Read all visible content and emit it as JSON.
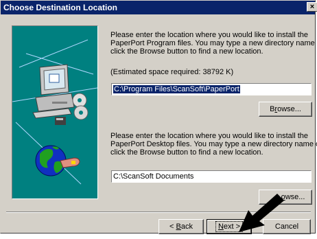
{
  "window": {
    "title": "Choose Destination Location",
    "close_label": "×"
  },
  "program_section": {
    "para_lines": [
      "Please enter the location where you would like to install the",
      "PaperPort Program files.  You may type a new directory name or",
      "click the Browse button to find a new location."
    ],
    "space_note": "(Estimated space required:  38792 K)",
    "path_value": "C:\\Program Files\\ScanSoft\\PaperPort",
    "browse_label_pre": "B",
    "browse_label_u": "r",
    "browse_label_post": "owse..."
  },
  "desktop_section": {
    "para_lines": [
      "Please enter the location where you would like to install the",
      "PaperPort Desktop files.  You may type a new directory name or",
      "click the Browse button to find a new location."
    ],
    "path_value": "C:\\ScanSoft Documents",
    "browse_label_u": "o",
    "browse_label_post": "wse..."
  },
  "footer": {
    "back_pre": "< ",
    "back_u": "B",
    "back_post": "ack",
    "next_u": "N",
    "next_post": "ext >",
    "cancel_label": "Cancel"
  },
  "colors": {
    "titlebar": "#0a246a",
    "dialog_face": "#d4d0c8",
    "illustration_bg": "#008080"
  },
  "icons": [
    "computer-icon",
    "cd-disc-icon",
    "globe-icon",
    "pointer-arrow-icon",
    "close-icon"
  ]
}
